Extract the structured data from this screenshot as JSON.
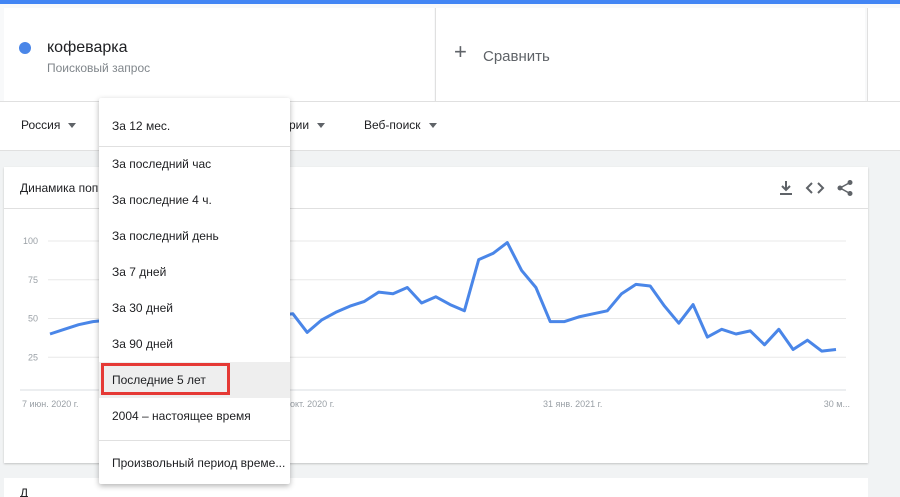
{
  "search_term": {
    "name": "кофеварка",
    "subtitle": "Поисковый запрос",
    "color": "#4a86e8"
  },
  "compare": {
    "label": "Сравнить"
  },
  "filters": [
    {
      "label": "Россия"
    },
    {
      "label": "рии"
    },
    {
      "label": "Веб-поиск"
    }
  ],
  "chart_card": {
    "title": "Динамика поп",
    "actions": [
      "download-icon",
      "embed-icon",
      "share-icon"
    ]
  },
  "chart_data": {
    "type": "line",
    "title": "Динамика поп",
    "series": [
      {
        "color": "#4a86e8",
        "values": [
          40,
          43,
          46,
          48,
          49,
          50,
          51,
          53,
          54,
          55,
          53,
          52,
          52,
          52,
          51,
          52,
          52,
          53,
          41,
          49,
          54,
          58,
          61,
          67,
          66,
          70,
          60,
          64,
          59,
          55,
          88,
          92,
          99,
          81,
          70,
          48,
          48,
          51,
          53,
          55,
          66,
          72,
          71,
          58,
          47,
          59,
          38,
          43,
          40,
          42,
          33,
          43,
          30,
          36,
          29,
          30
        ]
      }
    ],
    "yticks": [
      25,
      50,
      75,
      100
    ],
    "ylim": [
      0,
      100
    ],
    "xtick_labels": [
      "7 июн. 2020 г.",
      "окт. 2020 г.",
      "31 янв. 2021 г.",
      "30 м..."
    ],
    "grid": true
  },
  "dropdown": {
    "selected": "За 12 мес.",
    "items": [
      {
        "label": "За последний час"
      },
      {
        "label": "За последние 4 ч."
      },
      {
        "label": "За последний день"
      },
      {
        "label": "За 7 дней"
      },
      {
        "label": "За 30 дней"
      },
      {
        "label": "За 90 дней"
      },
      {
        "label": "Последние 5 лет",
        "highlighted": true
      },
      {
        "label": "2004 – настоящее время"
      }
    ],
    "custom": "Произвольный период време..."
  },
  "bottom_card": {
    "title": "Д"
  }
}
